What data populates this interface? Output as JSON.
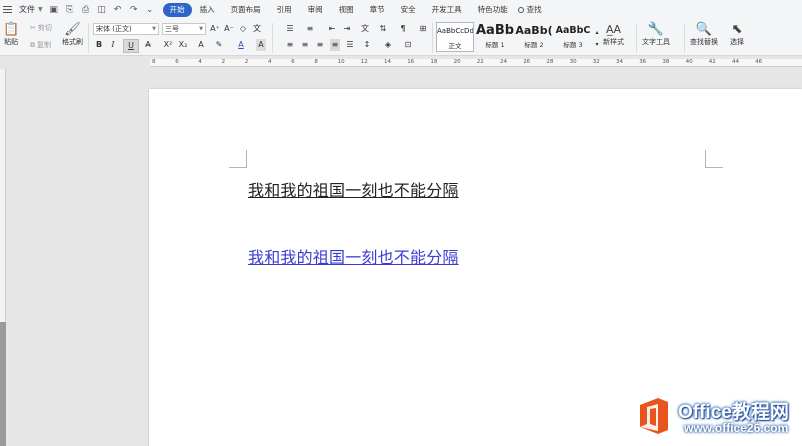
{
  "menu": {
    "file_label": "文件",
    "tabs": [
      {
        "label": "开始",
        "active": true
      },
      {
        "label": "插入",
        "active": false
      },
      {
        "label": "页面布局",
        "active": false
      },
      {
        "label": "引用",
        "active": false
      },
      {
        "label": "审阅",
        "active": false
      },
      {
        "label": "视图",
        "active": false
      },
      {
        "label": "章节",
        "active": false
      },
      {
        "label": "安全",
        "active": false
      },
      {
        "label": "开发工具",
        "active": false
      },
      {
        "label": "特色功能",
        "active": false
      }
    ],
    "find_label": "查找"
  },
  "ribbon": {
    "paste_label": "粘贴",
    "cut_label": "剪切",
    "copy_label": "复制",
    "format_painter_label": "格式刷",
    "font_name": "宋体 (正文)",
    "font_size": "三号",
    "styles": [
      {
        "preview": "AaBbCcDd",
        "name": "正文",
        "selected": true
      },
      {
        "preview": "AaBb",
        "name": "标题 1",
        "selected": false
      },
      {
        "preview": "AaBb(",
        "name": "标题 2",
        "selected": false
      },
      {
        "preview": "AaBbC",
        "name": "标题 3",
        "selected": false
      }
    ],
    "new_style_label": "新样式",
    "text_tools_label": "文字工具",
    "find_replace_label": "查找替换",
    "select_label": "选择"
  },
  "ruler": {
    "labels": [
      "8",
      "6",
      "4",
      "2",
      "2",
      "4",
      "6",
      "8",
      "10",
      "12",
      "14",
      "16",
      "18",
      "20",
      "22",
      "24",
      "26",
      "28",
      "30",
      "32",
      "34",
      "36",
      "38",
      "40",
      "42",
      "44",
      "46"
    ]
  },
  "document": {
    "line1": "我和我的祖国一刻也不能分隔",
    "line2": "我和我的祖国一刻也不能分隔"
  },
  "watermark": {
    "brand": "Office教程网",
    "url": "www.office26.com"
  },
  "colors": {
    "accent": "#2f64c9",
    "hyperlink": "#3b3bd4",
    "watermark_orange": "#e8541c"
  }
}
